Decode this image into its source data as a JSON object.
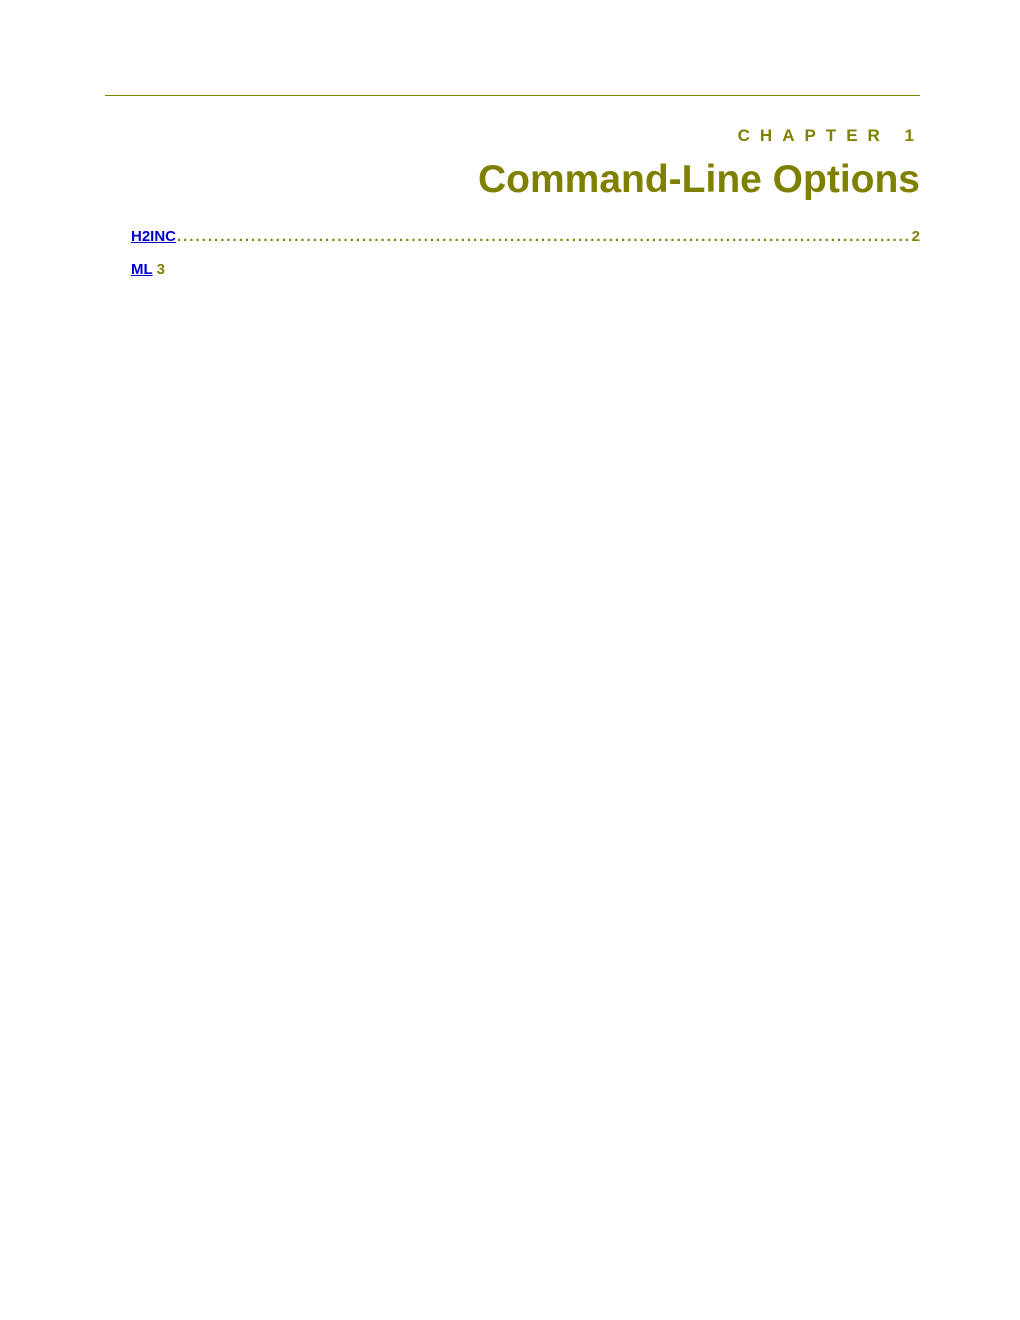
{
  "chapter": {
    "label": "CHAPTER 1",
    "title": "Command-Line Options"
  },
  "toc": [
    {
      "label": "H2INC",
      "page": "2",
      "dotted": true
    },
    {
      "label": "ML",
      "page": "3",
      "dotted": false
    }
  ],
  "leader": "......................................................................................................................................................................................................"
}
